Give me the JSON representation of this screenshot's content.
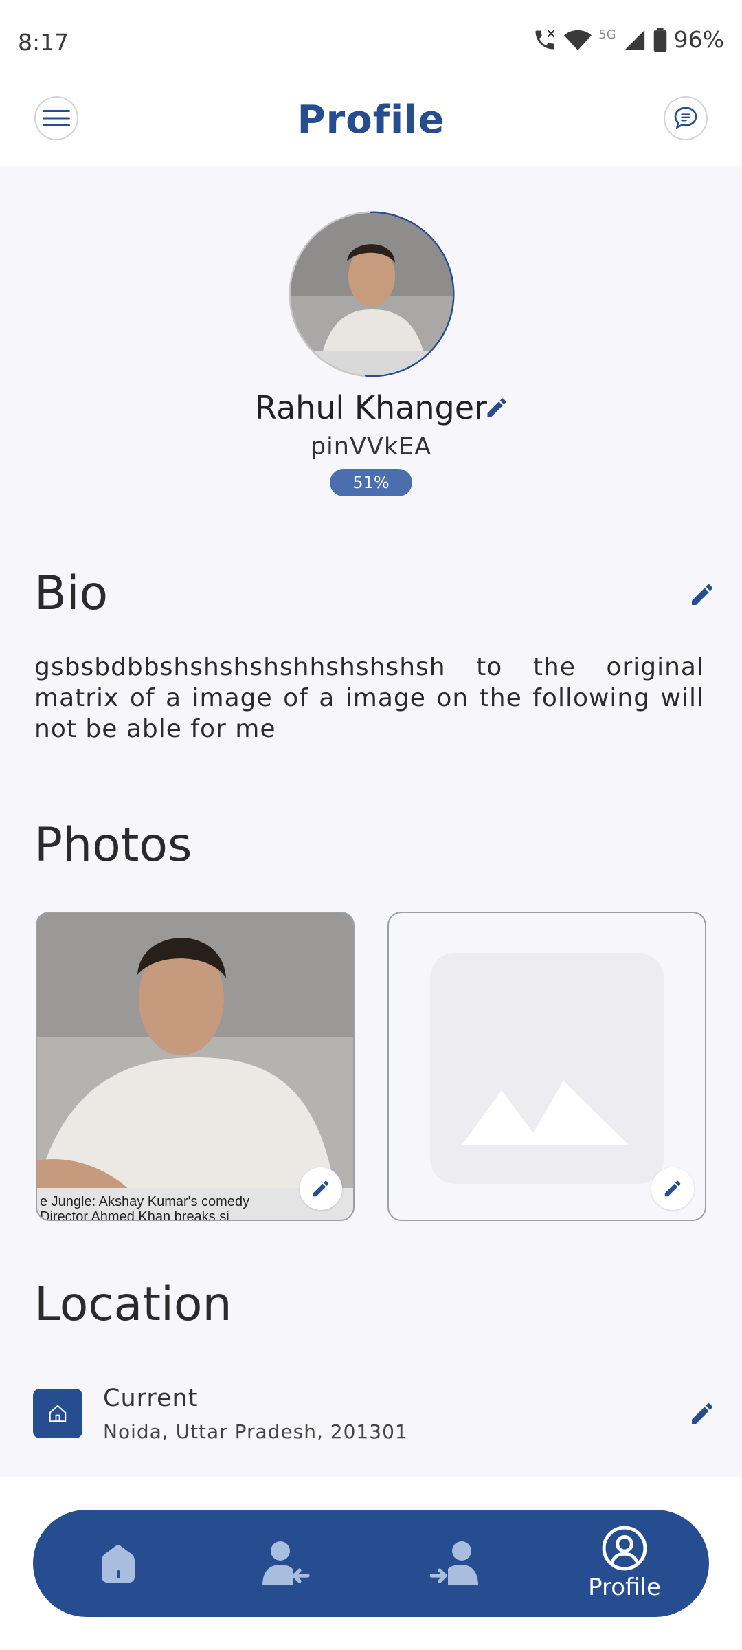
{
  "status": {
    "time": "8:17",
    "network": "5G",
    "battery": "96%"
  },
  "header": {
    "title": "Profile",
    "menu_icon": "hamburger-menu-icon",
    "chat_icon": "chat-bubble-icon"
  },
  "profile": {
    "name": "Rahul Khanger",
    "username": "pinVVkEA",
    "completion": "51%",
    "completion_value": 0.51
  },
  "bio": {
    "title": "Bio",
    "text": "gsbsbdbbshshshshshhshshshsh to the original matrix of a image of a image on the following will not be able for me"
  },
  "photos": {
    "title": "Photos",
    "caption_line1": "e Jungle: Akshay Kumar's comedy",
    "caption_line2": "Director Ahmed Khan breaks si"
  },
  "location": {
    "title": "Location",
    "label": "Current",
    "address": "Noida, Uttar Pradesh, 201301"
  },
  "nav": {
    "items": [
      {
        "icon": "home-icon",
        "label": ""
      },
      {
        "icon": "incoming-requests-icon",
        "label": ""
      },
      {
        "icon": "sent-requests-icon",
        "label": ""
      },
      {
        "icon": "profile-icon",
        "label": "Profile"
      }
    ]
  },
  "colors": {
    "primary": "#254d8f",
    "badge": "#4b6fae",
    "background": "#f6f6fb"
  }
}
